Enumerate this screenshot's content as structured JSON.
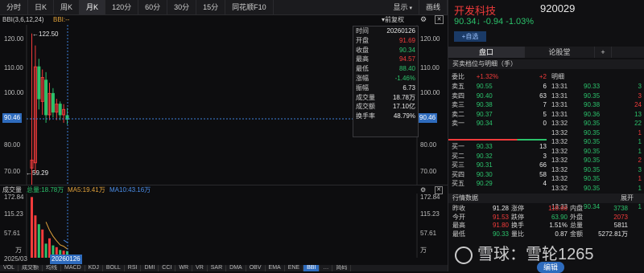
{
  "toolbar": {
    "items": [
      "分时",
      "日K",
      "周K",
      "月K",
      "120分",
      "60分",
      "30分",
      "15分",
      "同花顺F10"
    ],
    "active": "月K",
    "show": "显示",
    "draw": "画线"
  },
  "indicator_line": {
    "name": "BBI(3,6,12,24)",
    "value": "BBI:--",
    "rights": "前复权"
  },
  "kline": {
    "y_ticks": [
      "120.00",
      "110.00",
      "100.00",
      "90.00",
      "80.00",
      "70.00"
    ],
    "y_ticks_right": [
      "120.00",
      "110.00",
      "100.00",
      "90.00",
      "80.00",
      "70.00"
    ],
    "high_label": "←122.50",
    "low_label": "←59.29",
    "crosshair_value": "90.46",
    "crosshair_value_right": "90.46",
    "colors": {
      "up": "#f23b3b",
      "down": "#2bc26b",
      "bg": "#0d0d0f"
    }
  },
  "tooltip": {
    "rows": [
      {
        "k": "时间",
        "v": "20260126",
        "color": "#e8e8e8"
      },
      {
        "k": "开盘",
        "v": "91.69",
        "color": "#f23b3b"
      },
      {
        "k": "收盘",
        "v": "90.34",
        "color": "#2bc26b"
      },
      {
        "k": "最高",
        "v": "94.57",
        "color": "#f23b3b"
      },
      {
        "k": "最低",
        "v": "88.40",
        "color": "#2bc26b"
      },
      {
        "k": "涨幅",
        "v": "-1.46%",
        "color": "#2bc26b"
      },
      {
        "k": "振幅",
        "v": "6.73",
        "color": "#e8e8e8"
      },
      {
        "k": "成交量",
        "v": "18.78万",
        "color": "#e8e8e8"
      },
      {
        "k": "成交额",
        "v": "17.10亿",
        "color": "#e8e8e8"
      },
      {
        "k": "换手率",
        "v": "48.79%",
        "color": "#e8e8e8"
      }
    ]
  },
  "volume": {
    "label": "成交量",
    "total": "总量:18.78万",
    "ma5": "MA5:19.41万",
    "ma10": "MA10:43.16万",
    "y_ticks": [
      "172.84",
      "115.23",
      "57.61",
      "万"
    ],
    "y_ticks_right": [
      "172.84",
      "115.23",
      "57.61",
      "万"
    ],
    "x_start": "2025/03",
    "x_cursor": "20260126"
  },
  "bottom_tabs": [
    "VOL",
    "成交额",
    "均线",
    "MACD",
    "KDJ",
    "BOLL",
    "RSI",
    "DMI",
    "CCI",
    "WR",
    "VR",
    "SAR",
    "DMA",
    "OBV",
    "EMA",
    "ENE",
    "BBI",
    "…",
    "简码"
  ],
  "stock": {
    "name": "开发科技",
    "code": "920029",
    "price_line": "90.34↓ -0.94 -1.03%",
    "add_watch": "+自选"
  },
  "panel_tabs": [
    "盘口",
    "论股堂",
    "+"
  ],
  "depth": {
    "title": "买卖档位与明细（手）",
    "weibi_label": "委比",
    "weibi_value": "+1.32%",
    "weibi_diff": "+2",
    "mingxi": "明细",
    "sells": [
      {
        "l": "卖五",
        "p": "90.55",
        "v": "6"
      },
      {
        "l": "卖四",
        "p": "90.40",
        "v": "63"
      },
      {
        "l": "卖三",
        "p": "90.38",
        "v": "7"
      },
      {
        "l": "卖二",
        "p": "90.37",
        "v": "5"
      },
      {
        "l": "卖一",
        "p": "90.34",
        "v": "0"
      }
    ],
    "buys": [
      {
        "l": "买一",
        "p": "90.33",
        "v": "13"
      },
      {
        "l": "买二",
        "p": "90.32",
        "v": "3"
      },
      {
        "l": "买三",
        "p": "90.31",
        "v": "66"
      },
      {
        "l": "买四",
        "p": "90.30",
        "v": "58"
      },
      {
        "l": "买五",
        "p": "90.29",
        "v": "4"
      }
    ],
    "ticks": [
      {
        "t": "13:31",
        "p": "90.33",
        "v": "3",
        "c": "#2bc26b"
      },
      {
        "t": "13:31",
        "p": "90.35",
        "v": "3",
        "c": "#f23b3b"
      },
      {
        "t": "13:31",
        "p": "90.38",
        "v": "24",
        "c": "#f23b3b"
      },
      {
        "t": "13:31",
        "p": "90.36",
        "v": "13",
        "c": "#2bc26b"
      },
      {
        "t": "13:32",
        "p": "90.35",
        "v": "22",
        "c": "#2bc26b"
      },
      {
        "t": "13:32",
        "p": "90.35",
        "v": "1",
        "c": "#f23b3b"
      },
      {
        "t": "13:32",
        "p": "90.35",
        "v": "1",
        "c": "#2bc26b"
      },
      {
        "t": "13:32",
        "p": "90.35",
        "v": "1",
        "c": "#2bc26b"
      },
      {
        "t": "13:32",
        "p": "90.35",
        "v": "2",
        "c": "#f23b3b"
      },
      {
        "t": "13:32",
        "p": "90.35",
        "v": "3",
        "c": "#2bc26b"
      },
      {
        "t": "13:32",
        "p": "90.35",
        "v": "1",
        "c": "#f23b3b"
      },
      {
        "t": "13:32",
        "p": "90.35",
        "v": "1",
        "c": "#2bc26b"
      },
      {
        "t": "13:33",
        "p": "90.33",
        "v": "1",
        "c": "#2bc26b"
      },
      {
        "t": "13:33",
        "p": "90.34",
        "v": "1",
        "c": "#2bc26b"
      }
    ]
  },
  "quote": {
    "title": "行情数据",
    "expand": "展开",
    "rows": [
      [
        {
          "k": "昨收",
          "v": "91.28",
          "c": "#e8e8e8"
        },
        {
          "k": "涨停",
          "v": "118.66",
          "c": "#f23b3b"
        },
        {
          "k": "内盘",
          "v": "3738",
          "c": "#2bc26b"
        }
      ],
      [
        {
          "k": "今开",
          "v": "91.53",
          "c": "#f23b3b"
        },
        {
          "k": "跌停",
          "v": "63.90",
          "c": "#2bc26b"
        },
        {
          "k": "外盘",
          "v": "2073",
          "c": "#f23b3b"
        }
      ],
      [
        {
          "k": "最高",
          "v": "91.80",
          "c": "#f23b3b"
        },
        {
          "k": "换手",
          "v": "1.51%",
          "c": "#e8e8e8"
        },
        {
          "k": "总量",
          "v": "5811",
          "c": "#e8e8e8"
        }
      ],
      [
        {
          "k": "最低",
          "v": "90.33",
          "c": "#2bc26b"
        },
        {
          "k": "量比",
          "v": "0.87",
          "c": "#e8e8e8"
        },
        {
          "k": "金额",
          "v": "5272.81万",
          "c": "#e8e8e8"
        }
      ]
    ]
  },
  "watermark": "雪球：雪轮1265",
  "edit_button": "编辑"
}
